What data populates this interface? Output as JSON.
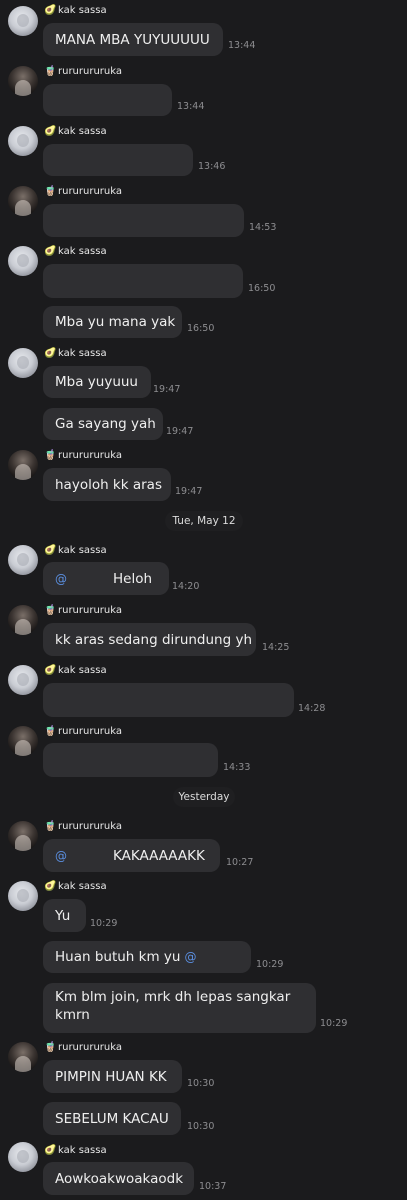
{
  "senders": {
    "kak_sassa": "kak sassa",
    "rururu": "rururururuka"
  },
  "icons": {
    "avocado": "🥑",
    "bubble_tea": "🧋"
  },
  "messages": [
    {
      "text": "MANA MBA YUYUUUUU",
      "time": "13:44"
    },
    {
      "text": "",
      "time": "13:44"
    },
    {
      "text": "",
      "time": "13:46"
    },
    {
      "text": "",
      "time": "14:53"
    },
    {
      "text": "",
      "time": "16:50"
    },
    {
      "text": "Mba yu mana yak",
      "time": "16:50"
    },
    {
      "text": "Mba yuyuuu",
      "time": "19:47"
    },
    {
      "text": "Ga sayang yah",
      "time": "19:47"
    },
    {
      "text": "hayoloh kk aras",
      "time": "19:47"
    },
    {
      "text": "Heloh",
      "time": "14:20",
      "mention": "@"
    },
    {
      "text": "kk aras sedang dirundung yh",
      "time": "14:25"
    },
    {
      "text": "",
      "time": "14:28"
    },
    {
      "text": "",
      "time": "14:33"
    },
    {
      "text": "KAKAAAAAKK",
      "time": "10:27",
      "mention": "@"
    },
    {
      "text": "Yu",
      "time": "10:29"
    },
    {
      "text": "Huan butuh km yu",
      "time": "10:29",
      "mention": "@"
    },
    {
      "text": "Km blm join, mrk dh lepas sangkar kmrn",
      "time": "10:29"
    },
    {
      "text": "PIMPIN HUAN KK",
      "time": "10:30"
    },
    {
      "text": "SEBELUM KACAU",
      "time": "10:30"
    },
    {
      "text": "Aowkoakwoakaodk",
      "time": "10:37"
    }
  ],
  "dividers": {
    "may12": "Tue, May 12",
    "yesterday": "Yesterday"
  }
}
